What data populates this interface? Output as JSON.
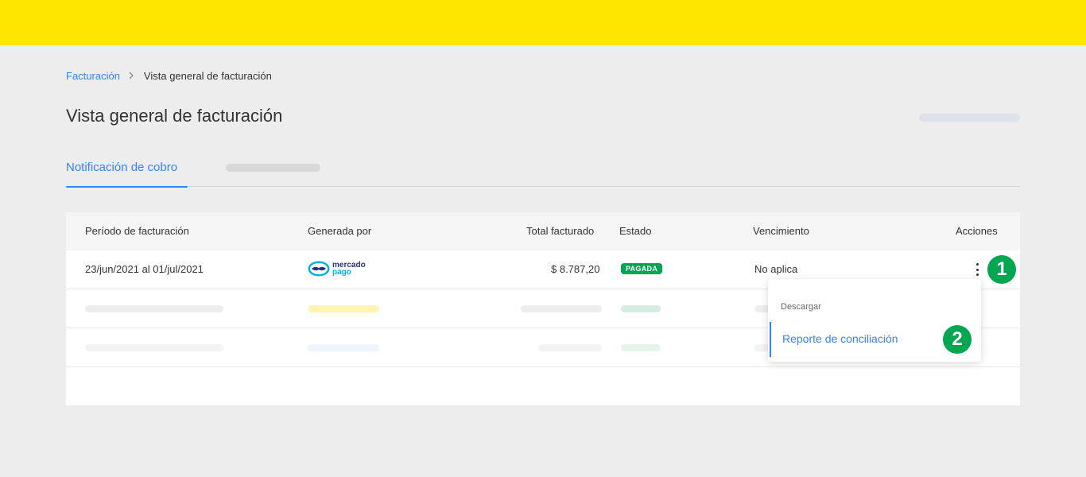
{
  "colors": {
    "brand_yellow": "#ffe600",
    "accent_blue": "#3483fa",
    "status_green": "#00a650"
  },
  "breadcrumb": {
    "parent": "Facturación",
    "separator_icon": "chevron-right-icon",
    "current": "Vista general de facturación"
  },
  "page": {
    "title": "Vista general de facturación"
  },
  "tabs": [
    {
      "label": "Notificación de cobro",
      "active": true
    }
  ],
  "table": {
    "headers": [
      "Período de facturación",
      "Generada por",
      "Total facturado",
      "Estado",
      "Vencimiento",
      "Acciones"
    ],
    "rows": [
      {
        "period": "23/jun/2021 al 01/jul/2021",
        "generated_by": {
          "icon": "mercado-pago-logo-icon",
          "line1": "mercado",
          "line2": "pago"
        },
        "total": "$ 8.787,20",
        "status": "PAGADA",
        "due": "No aplica",
        "actions_icon": "more-vertical-icon"
      }
    ]
  },
  "dropdown": {
    "header": "Descargar",
    "item": "Reporte de conciliación"
  },
  "steps": [
    "1",
    "2"
  ]
}
